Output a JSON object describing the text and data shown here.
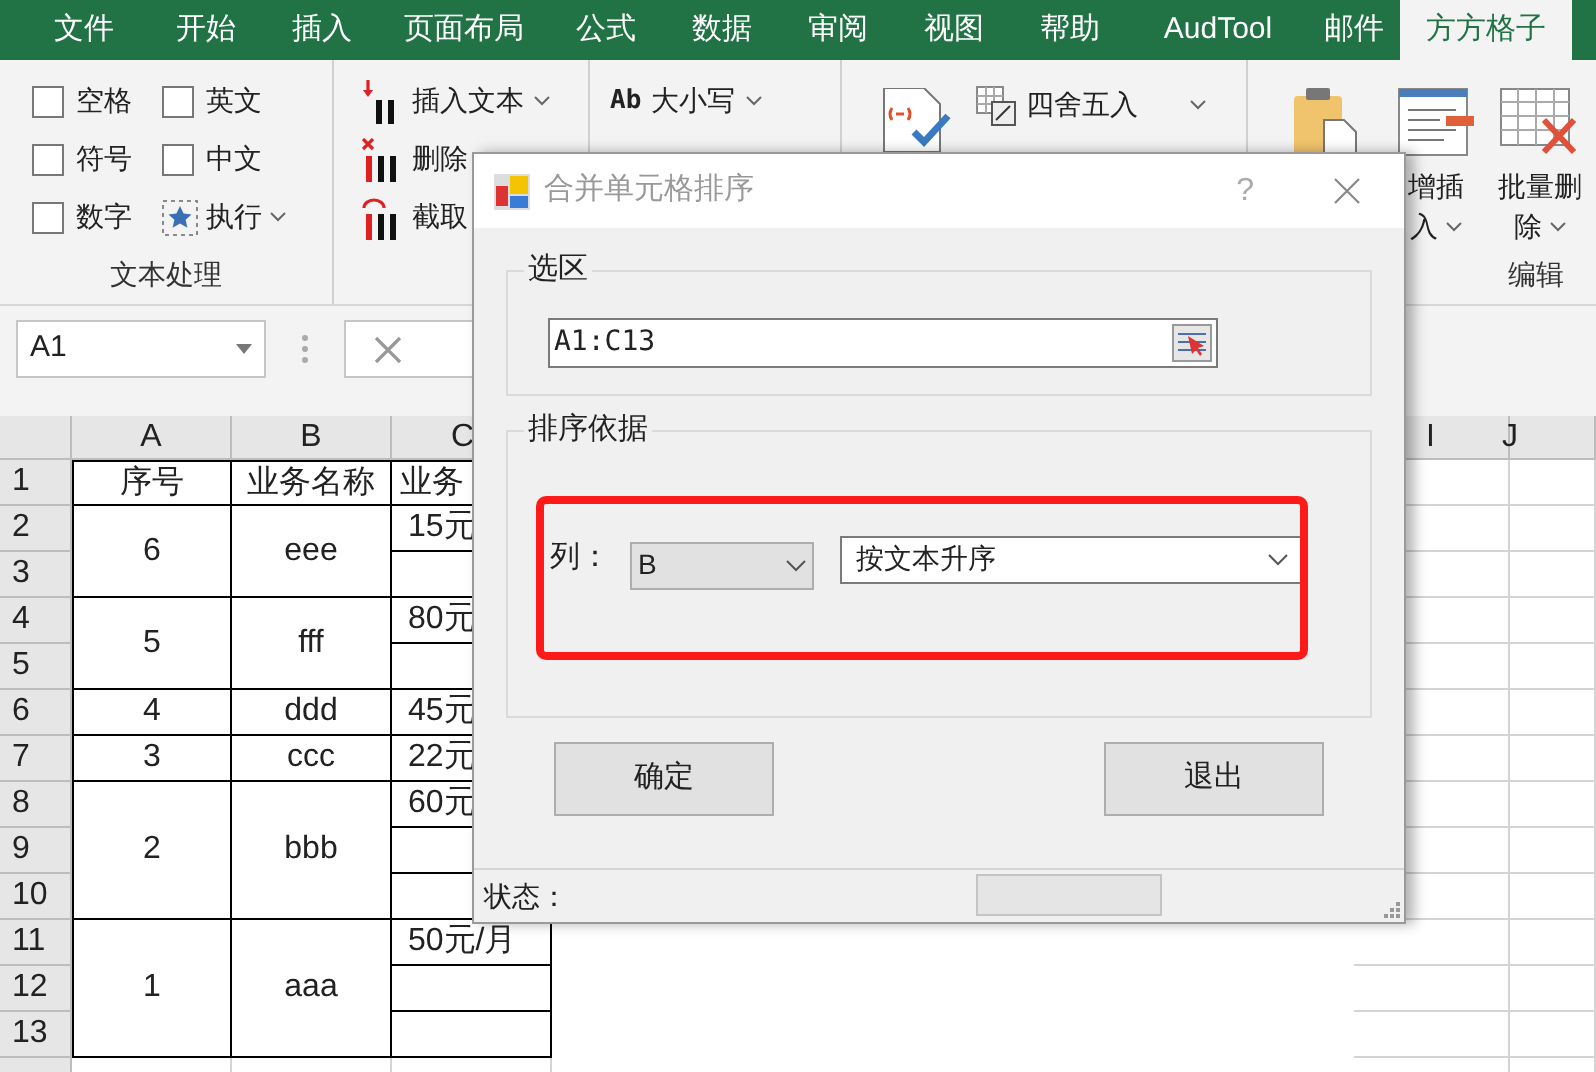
{
  "ribbon_tabs": [
    {
      "label": "文件",
      "selected": false
    },
    {
      "label": "开始",
      "selected": false
    },
    {
      "label": "插入",
      "selected": false
    },
    {
      "label": "页面布局",
      "selected": false
    },
    {
      "label": "公式",
      "selected": false
    },
    {
      "label": "数据",
      "selected": false
    },
    {
      "label": "审阅",
      "selected": false
    },
    {
      "label": "视图",
      "selected": false
    },
    {
      "label": "帮助",
      "selected": false
    },
    {
      "label": "AudTool",
      "selected": false
    },
    {
      "label": "邮件",
      "selected": false
    },
    {
      "label": "方方格子",
      "selected": true
    }
  ],
  "ribbon": {
    "text_group": {
      "label": "文本处理",
      "items": [
        {
          "kind": "checkbox",
          "label": "空格",
          "checked": false
        },
        {
          "kind": "checkbox",
          "label": "英文",
          "checked": false
        },
        {
          "kind": "checkbox",
          "label": "符号",
          "checked": false
        },
        {
          "kind": "checkbox",
          "label": "中文",
          "checked": false
        },
        {
          "kind": "checkbox",
          "label": "数字",
          "checked": false
        },
        {
          "kind": "command",
          "label": "执行",
          "dropdown": true
        }
      ]
    },
    "insert_commands": [
      {
        "label": "插入文本",
        "dropdown": true
      },
      {
        "label": "删除"
      },
      {
        "label": "截取"
      }
    ],
    "case_command": {
      "icon_text": "Ab",
      "label": "大小写",
      "dropdown": true
    },
    "round_command": {
      "label": "四舍五入",
      "dropdown": true
    },
    "edit_group": {
      "label": "编辑",
      "buttons": [
        {
          "lines": [
            "增插",
            "入"
          ],
          "dropdown": true
        },
        {
          "lines": [
            "批量删",
            "除"
          ],
          "dropdown": true
        }
      ]
    }
  },
  "name_box": "A1",
  "sheet": {
    "columns": [
      "A",
      "B",
      "C",
      "I",
      "J"
    ],
    "header": {
      "row": "1",
      "cells": [
        "序号",
        "业务名称",
        "业务"
      ]
    },
    "records": [
      {
        "rows": [
          "2",
          "3"
        ],
        "seq": "6",
        "name": "eee",
        "amount": "15元"
      },
      {
        "rows": [
          "4",
          "5"
        ],
        "seq": "5",
        "name": "fff",
        "amount": "80元"
      },
      {
        "rows": [
          "6"
        ],
        "seq": "4",
        "name": "ddd",
        "amount": "45元"
      },
      {
        "rows": [
          "7"
        ],
        "seq": "3",
        "name": "ccc",
        "amount": "22元"
      },
      {
        "rows": [
          "8",
          "9",
          "10"
        ],
        "seq": "2",
        "name": "bbb",
        "amount": "60元"
      },
      {
        "rows": [
          "11",
          "12",
          "13"
        ],
        "seq": "1",
        "name": "aaa",
        "amount": "50元/月"
      }
    ]
  },
  "dialog": {
    "title": "合并单元格排序",
    "help": "?",
    "selection": {
      "legend": "选区",
      "value": "A1:C13"
    },
    "sort": {
      "legend": "排序依据",
      "column_label": "列：",
      "column_value": "B",
      "order_value": "按文本升序"
    },
    "buttons": [
      "确定",
      "退出"
    ],
    "status_label": "状态："
  }
}
